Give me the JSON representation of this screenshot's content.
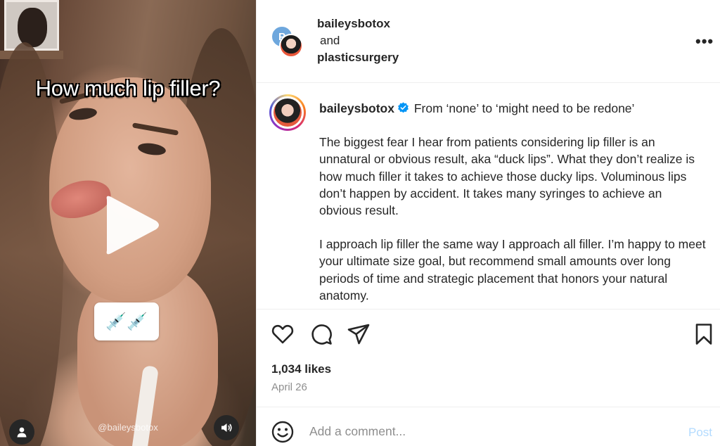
{
  "video": {
    "caption_overlay": "How much lip filler?",
    "watermark": "@baileysbotox",
    "emoji_chip": "💉💉"
  },
  "header": {
    "collab_user_1": "baileysbotox",
    "collab_joiner": "and",
    "collab_user_2": "plasticsurgery",
    "collab_avatar_initial": "P",
    "more_label": "•••"
  },
  "caption": {
    "username": "baileysbotox",
    "headline": "From ‘none’ to ‘might need to be redone’",
    "paragraphs": [
      "The biggest fear I hear from patients considering lip filler is an unnatural or obvious result, aka “duck lips”. What they don’t realize is how much filler it takes to achieve those ducky lips. Voluminous lips don’t happen by accident. It takes many syringes to achieve an obvious result.",
      "I approach lip filler the same way I approach all filler. I’m happy to meet your ultimate size goal, but recommend small amounts over long periods of time and strategic placement that honors your natural anatomy."
    ]
  },
  "stats": {
    "likes": "1,034 likes",
    "date": "April 26"
  },
  "comment": {
    "placeholder": "Add a comment...",
    "post_label": "Post"
  },
  "colors": {
    "verified": "#0095f6",
    "post_disabled": "#b3dbff",
    "text": "#262626",
    "muted": "#8e8e8e"
  },
  "icons": [
    "play-icon",
    "user-icon",
    "speaker-icon",
    "verified-icon",
    "heart-icon",
    "comment-icon",
    "share-icon",
    "bookmark-icon",
    "emoji-icon",
    "more-icon"
  ]
}
